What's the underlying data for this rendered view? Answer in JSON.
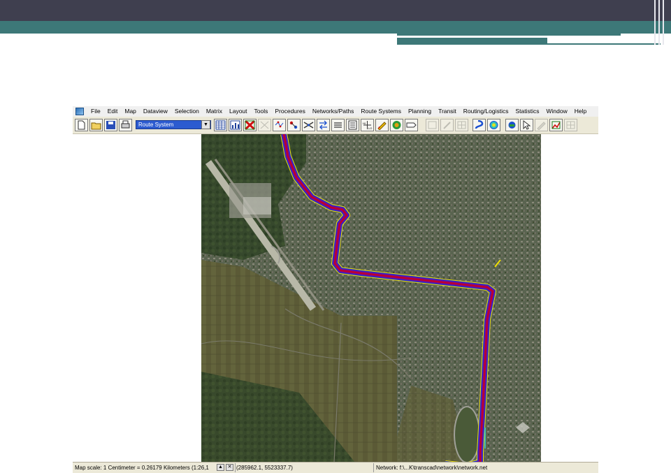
{
  "app": {
    "menu": [
      "File",
      "Edit",
      "Map",
      "Dataview",
      "Selection",
      "Matrix",
      "Layout",
      "Tools",
      "Procedures",
      "Networks/Paths",
      "Route Systems",
      "Planning",
      "Transit",
      "Routing/Logistics",
      "Statistics",
      "Window",
      "Help"
    ],
    "toolbar": {
      "route_system_value": "Route System",
      "icons": [
        "new-file-icon",
        "open-folder-icon",
        "save-icon",
        "print-icon",
        "dataview-icon",
        "chart-icon",
        "select-icon",
        "grid-icon",
        "network-icon",
        "nodes-icon",
        "scissors-icon",
        "transfer-icon",
        "layers-icon",
        "table-icon",
        "hi-lo-icon",
        "pencil-icon",
        "globe-icon",
        "label-icon",
        "disabled-icon",
        "pin-icon",
        "grid-layout-icon",
        "route-icon",
        "coverage-icon",
        "map-icon",
        "cursor-icon",
        "edit-icon",
        "chart-edit-icon",
        "disabled-grid-icon"
      ]
    },
    "status": {
      "map_scale": "Map scale: 1 Centimeter = 0.26179 Kilometers (1:26,1",
      "coordinates": "(285962.1, 5523337.7)",
      "network": "Network: f:\\...K\\transcad\\network\\network.net"
    },
    "colors": {
      "route_primary": "#c0002a",
      "route_secondary": "#6a0fa0",
      "route_tertiary": "#1a2fd8",
      "route_highlight": "#f2e000"
    }
  }
}
